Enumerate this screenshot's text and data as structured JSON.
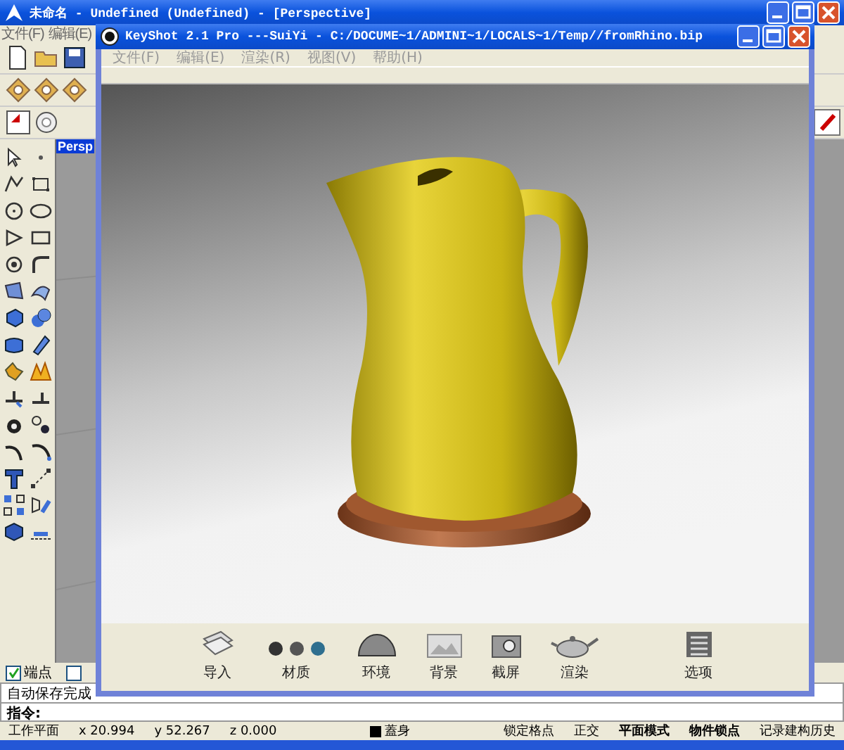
{
  "rhino_window": {
    "title": "未命名 - Undefined (Undefined) - [Perspective]",
    "menu": [
      "文件(F)",
      "编辑(E)"
    ],
    "viewport_tab": "Persp",
    "osnap": [
      {
        "label": "端点",
        "checked": true
      },
      {
        "checked": false
      }
    ],
    "command_history": "自动保存完成",
    "command_prompt": "指令:",
    "status_bar": {
      "cplane": "工作平面",
      "x": "x 20.994",
      "y": "y 52.267",
      "z": "z 0.000",
      "layer": {
        "name": "蓋身",
        "color": "#000000"
      },
      "toggles": [
        {
          "label": "锁定格点",
          "on": false
        },
        {
          "label": "正交",
          "on": false
        },
        {
          "label": "平面模式",
          "on": true
        },
        {
          "label": "物件锁点",
          "on": true
        },
        {
          "label": "记录建构历史",
          "on": false
        }
      ]
    }
  },
  "keyshot_window": {
    "title": "KeyShot 2.1 Pro ---SuiYi - C:/DOCUME~1/ADMINI~1/LOCALS~1/Temp//fromRhino.bip",
    "menu": [
      "文件(F)",
      "编辑(E)",
      "渲染(R)",
      "视图(V)",
      "帮助(H)"
    ],
    "toolbar": [
      {
        "kind": "import",
        "label": "导入"
      },
      {
        "kind": "materials",
        "label": "材质"
      },
      {
        "kind": "environment",
        "label": "环境"
      },
      {
        "kind": "background",
        "label": "背景"
      },
      {
        "kind": "screenshot",
        "label": "截屏"
      },
      {
        "kind": "render",
        "label": "渲染"
      },
      {
        "kind": "options",
        "label": "选项"
      }
    ]
  }
}
